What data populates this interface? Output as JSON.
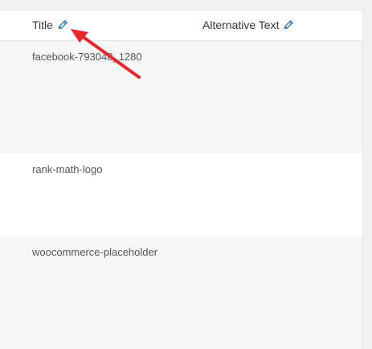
{
  "table": {
    "columns": {
      "title": {
        "label": "Title",
        "edit_icon": "pencil-icon"
      },
      "alt_text": {
        "label": "Alternative Text",
        "edit_icon": "pencil-icon"
      }
    },
    "rows": [
      {
        "title": "facebook-793048_1280",
        "alt_text": ""
      },
      {
        "title": "rank-math-logo",
        "alt_text": ""
      },
      {
        "title": "woocommerce-placeholder",
        "alt_text": ""
      }
    ]
  },
  "colors": {
    "pencil": "#2271b1",
    "annotation_arrow": "#e8262b",
    "row_shaded": "#f7f7f7",
    "row_plain": "#ffffff"
  }
}
